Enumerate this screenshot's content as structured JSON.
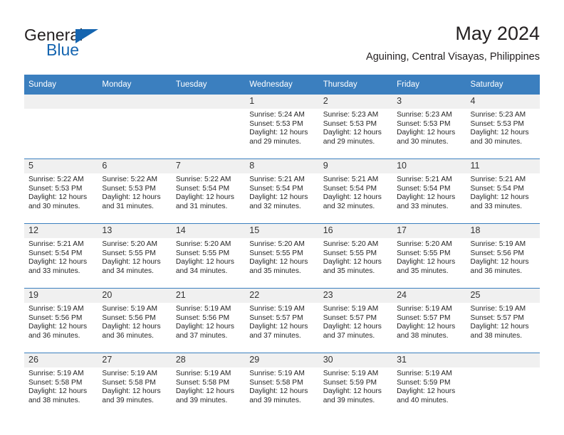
{
  "logo": {
    "primary_text": "General",
    "secondary_text": "Blue",
    "accent_color": "#1565b0",
    "triangle_icon": "blue-triangle-icon"
  },
  "header": {
    "title": "May 2024",
    "subtitle": "Aguining, Central Visayas, Philippines"
  },
  "theme": {
    "header_bg": "#3b7fbf",
    "daynum_bg": "#f0f0f0",
    "row_border": "#3b7fbf",
    "text": "#262626"
  },
  "calendar": {
    "weekday_headers": [
      "Sunday",
      "Monday",
      "Tuesday",
      "Wednesday",
      "Thursday",
      "Friday",
      "Saturday"
    ],
    "weeks": [
      [
        {
          "day": "",
          "sunrise": "",
          "sunset": "",
          "daylight": "",
          "daylight2": ""
        },
        {
          "day": "",
          "sunrise": "",
          "sunset": "",
          "daylight": "",
          "daylight2": ""
        },
        {
          "day": "",
          "sunrise": "",
          "sunset": "",
          "daylight": "",
          "daylight2": ""
        },
        {
          "day": "1",
          "sunrise": "Sunrise: 5:24 AM",
          "sunset": "Sunset: 5:53 PM",
          "daylight": "Daylight: 12 hours",
          "daylight2": "and 29 minutes."
        },
        {
          "day": "2",
          "sunrise": "Sunrise: 5:23 AM",
          "sunset": "Sunset: 5:53 PM",
          "daylight": "Daylight: 12 hours",
          "daylight2": "and 29 minutes."
        },
        {
          "day": "3",
          "sunrise": "Sunrise: 5:23 AM",
          "sunset": "Sunset: 5:53 PM",
          "daylight": "Daylight: 12 hours",
          "daylight2": "and 30 minutes."
        },
        {
          "day": "4",
          "sunrise": "Sunrise: 5:23 AM",
          "sunset": "Sunset: 5:53 PM",
          "daylight": "Daylight: 12 hours",
          "daylight2": "and 30 minutes."
        }
      ],
      [
        {
          "day": "5",
          "sunrise": "Sunrise: 5:22 AM",
          "sunset": "Sunset: 5:53 PM",
          "daylight": "Daylight: 12 hours",
          "daylight2": "and 30 minutes."
        },
        {
          "day": "6",
          "sunrise": "Sunrise: 5:22 AM",
          "sunset": "Sunset: 5:53 PM",
          "daylight": "Daylight: 12 hours",
          "daylight2": "and 31 minutes."
        },
        {
          "day": "7",
          "sunrise": "Sunrise: 5:22 AM",
          "sunset": "Sunset: 5:54 PM",
          "daylight": "Daylight: 12 hours",
          "daylight2": "and 31 minutes."
        },
        {
          "day": "8",
          "sunrise": "Sunrise: 5:21 AM",
          "sunset": "Sunset: 5:54 PM",
          "daylight": "Daylight: 12 hours",
          "daylight2": "and 32 minutes."
        },
        {
          "day": "9",
          "sunrise": "Sunrise: 5:21 AM",
          "sunset": "Sunset: 5:54 PM",
          "daylight": "Daylight: 12 hours",
          "daylight2": "and 32 minutes."
        },
        {
          "day": "10",
          "sunrise": "Sunrise: 5:21 AM",
          "sunset": "Sunset: 5:54 PM",
          "daylight": "Daylight: 12 hours",
          "daylight2": "and 33 minutes."
        },
        {
          "day": "11",
          "sunrise": "Sunrise: 5:21 AM",
          "sunset": "Sunset: 5:54 PM",
          "daylight": "Daylight: 12 hours",
          "daylight2": "and 33 minutes."
        }
      ],
      [
        {
          "day": "12",
          "sunrise": "Sunrise: 5:21 AM",
          "sunset": "Sunset: 5:54 PM",
          "daylight": "Daylight: 12 hours",
          "daylight2": "and 33 minutes."
        },
        {
          "day": "13",
          "sunrise": "Sunrise: 5:20 AM",
          "sunset": "Sunset: 5:55 PM",
          "daylight": "Daylight: 12 hours",
          "daylight2": "and 34 minutes."
        },
        {
          "day": "14",
          "sunrise": "Sunrise: 5:20 AM",
          "sunset": "Sunset: 5:55 PM",
          "daylight": "Daylight: 12 hours",
          "daylight2": "and 34 minutes."
        },
        {
          "day": "15",
          "sunrise": "Sunrise: 5:20 AM",
          "sunset": "Sunset: 5:55 PM",
          "daylight": "Daylight: 12 hours",
          "daylight2": "and 35 minutes."
        },
        {
          "day": "16",
          "sunrise": "Sunrise: 5:20 AM",
          "sunset": "Sunset: 5:55 PM",
          "daylight": "Daylight: 12 hours",
          "daylight2": "and 35 minutes."
        },
        {
          "day": "17",
          "sunrise": "Sunrise: 5:20 AM",
          "sunset": "Sunset: 5:55 PM",
          "daylight": "Daylight: 12 hours",
          "daylight2": "and 35 minutes."
        },
        {
          "day": "18",
          "sunrise": "Sunrise: 5:19 AM",
          "sunset": "Sunset: 5:56 PM",
          "daylight": "Daylight: 12 hours",
          "daylight2": "and 36 minutes."
        }
      ],
      [
        {
          "day": "19",
          "sunrise": "Sunrise: 5:19 AM",
          "sunset": "Sunset: 5:56 PM",
          "daylight": "Daylight: 12 hours",
          "daylight2": "and 36 minutes."
        },
        {
          "day": "20",
          "sunrise": "Sunrise: 5:19 AM",
          "sunset": "Sunset: 5:56 PM",
          "daylight": "Daylight: 12 hours",
          "daylight2": "and 36 minutes."
        },
        {
          "day": "21",
          "sunrise": "Sunrise: 5:19 AM",
          "sunset": "Sunset: 5:56 PM",
          "daylight": "Daylight: 12 hours",
          "daylight2": "and 37 minutes."
        },
        {
          "day": "22",
          "sunrise": "Sunrise: 5:19 AM",
          "sunset": "Sunset: 5:57 PM",
          "daylight": "Daylight: 12 hours",
          "daylight2": "and 37 minutes."
        },
        {
          "day": "23",
          "sunrise": "Sunrise: 5:19 AM",
          "sunset": "Sunset: 5:57 PM",
          "daylight": "Daylight: 12 hours",
          "daylight2": "and 37 minutes."
        },
        {
          "day": "24",
          "sunrise": "Sunrise: 5:19 AM",
          "sunset": "Sunset: 5:57 PM",
          "daylight": "Daylight: 12 hours",
          "daylight2": "and 38 minutes."
        },
        {
          "day": "25",
          "sunrise": "Sunrise: 5:19 AM",
          "sunset": "Sunset: 5:57 PM",
          "daylight": "Daylight: 12 hours",
          "daylight2": "and 38 minutes."
        }
      ],
      [
        {
          "day": "26",
          "sunrise": "Sunrise: 5:19 AM",
          "sunset": "Sunset: 5:58 PM",
          "daylight": "Daylight: 12 hours",
          "daylight2": "and 38 minutes."
        },
        {
          "day": "27",
          "sunrise": "Sunrise: 5:19 AM",
          "sunset": "Sunset: 5:58 PM",
          "daylight": "Daylight: 12 hours",
          "daylight2": "and 39 minutes."
        },
        {
          "day": "28",
          "sunrise": "Sunrise: 5:19 AM",
          "sunset": "Sunset: 5:58 PM",
          "daylight": "Daylight: 12 hours",
          "daylight2": "and 39 minutes."
        },
        {
          "day": "29",
          "sunrise": "Sunrise: 5:19 AM",
          "sunset": "Sunset: 5:58 PM",
          "daylight": "Daylight: 12 hours",
          "daylight2": "and 39 minutes."
        },
        {
          "day": "30",
          "sunrise": "Sunrise: 5:19 AM",
          "sunset": "Sunset: 5:59 PM",
          "daylight": "Daylight: 12 hours",
          "daylight2": "and 39 minutes."
        },
        {
          "day": "31",
          "sunrise": "Sunrise: 5:19 AM",
          "sunset": "Sunset: 5:59 PM",
          "daylight": "Daylight: 12 hours",
          "daylight2": "and 40 minutes."
        },
        {
          "day": "",
          "sunrise": "",
          "sunset": "",
          "daylight": "",
          "daylight2": ""
        }
      ]
    ]
  }
}
